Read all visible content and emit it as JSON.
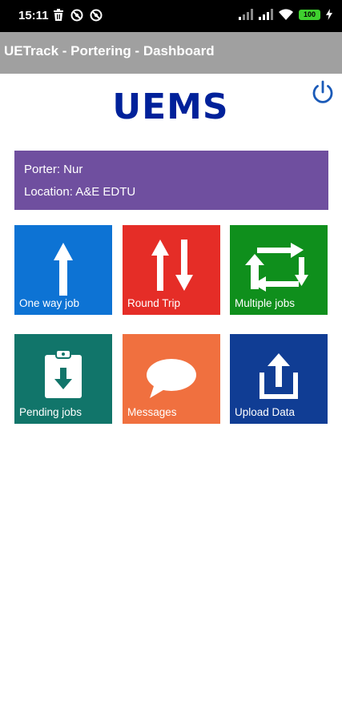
{
  "status_bar": {
    "time": "15:11",
    "battery": "100",
    "left_icons": [
      "trash-icon",
      "blocked-circle-icon",
      "blocked-circle-icon"
    ],
    "right_icons": [
      "signal-icon",
      "signal-icon",
      "wifi-icon",
      "battery-icon",
      "charging-icon"
    ]
  },
  "app_bar": {
    "title": "UETrack - Portering - Dashboard"
  },
  "header": {
    "logo_text": "UEMS",
    "logo_color": "#00219a",
    "power_icon": "power-icon"
  },
  "info": {
    "porter": "Porter: Nur",
    "location": "Location: A&E EDTU",
    "background": "#6f4f9f"
  },
  "tiles": [
    {
      "label": "One way job",
      "icon": "arrow-up-icon",
      "color": "#0d73d4"
    },
    {
      "label": "Round Trip",
      "icon": "up-down-arrows-icon",
      "color": "#e52d27"
    },
    {
      "label": "Multiple jobs",
      "icon": "cycle-arrows-icon",
      "color": "#0f8f1c"
    },
    {
      "label": "Pending jobs",
      "icon": "clipboard-download-icon",
      "color": "#11756a"
    },
    {
      "label": "Messages",
      "icon": "speech-bubble-icon",
      "color": "#f0703f"
    },
    {
      "label": "Upload Data",
      "icon": "upload-icon",
      "color": "#103d94"
    }
  ]
}
